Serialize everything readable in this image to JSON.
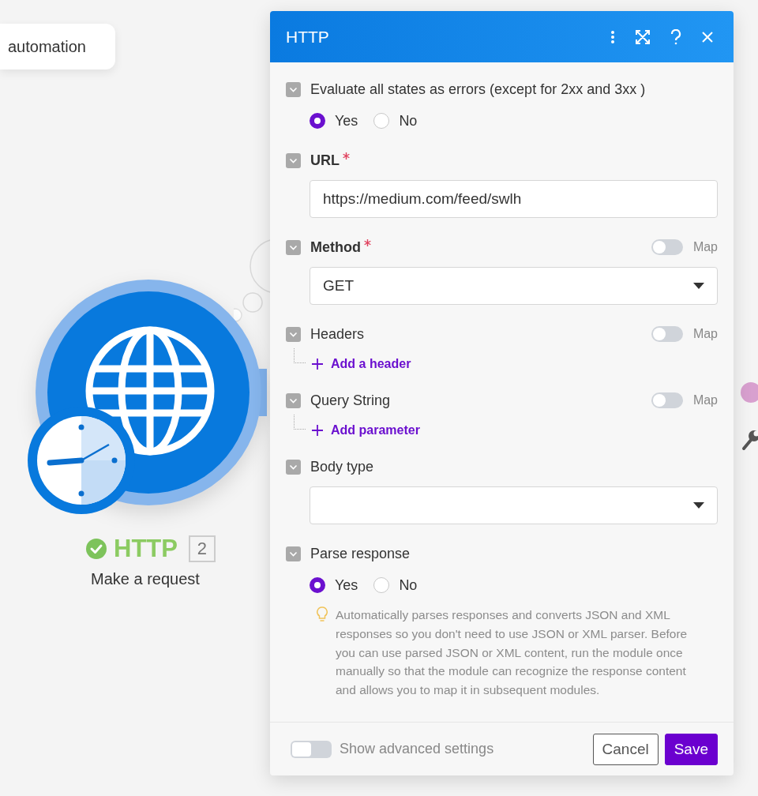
{
  "canvas": {
    "chip": {
      "text": "automation"
    },
    "node": {
      "title": "HTTP",
      "succeeded": true,
      "count": "2",
      "subtitle": "Make a request"
    }
  },
  "panel": {
    "title": "HTTP",
    "fields": [
      {
        "kind": "radio",
        "label": "Evaluate all states as errors (except for 2xx and 3xx )",
        "required": false,
        "options": [
          {
            "label": "Yes",
            "selected": true
          },
          {
            "label": "No",
            "selected": false
          }
        ]
      },
      {
        "kind": "text",
        "label": "URL",
        "required": true,
        "value": "https://medium.com/feed/swlh"
      },
      {
        "kind": "select",
        "label": "Method",
        "required": true,
        "map": {
          "label": "Map",
          "on": false
        },
        "value": "GET"
      },
      {
        "kind": "list",
        "label": "Headers",
        "required": false,
        "map": {
          "label": "Map",
          "on": false
        },
        "add": "Add a header"
      },
      {
        "kind": "list",
        "label": "Query String",
        "required": false,
        "map": {
          "label": "Map",
          "on": false
        },
        "add": "Add parameter"
      },
      {
        "kind": "select",
        "label": "Body type",
        "required": false
      },
      {
        "kind": "radio",
        "label": "Parse response",
        "required": false,
        "options": [
          {
            "label": "Yes",
            "selected": true
          },
          {
            "label": "No",
            "selected": false
          }
        ],
        "hint": "Automatically parses responses and converts JSON and XML responses so you don't need to use JSON or XML parser. Before you can use parsed JSON or XML content, run the module once manually so that the module can recognize the response content and allows you to map it in subsequent modules."
      }
    ],
    "footer": {
      "advanced": {
        "label": "Show advanced settings",
        "on": false
      },
      "buttons": [
        {
          "label": "Cancel",
          "kind": "secondary"
        },
        {
          "label": "Save",
          "kind": "primary"
        }
      ]
    }
  }
}
